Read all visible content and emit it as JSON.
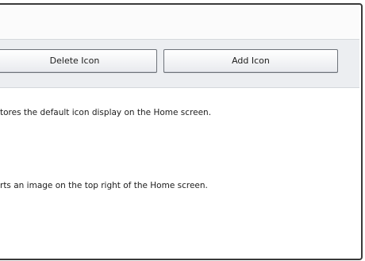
{
  "buttons": {
    "delete_icon": "Delete Icon",
    "add_icon": "Add Icon"
  },
  "descriptions": {
    "restore": "tores the default icon display on the Home screen.",
    "insert": "rts an image on the top right of the Home screen."
  }
}
